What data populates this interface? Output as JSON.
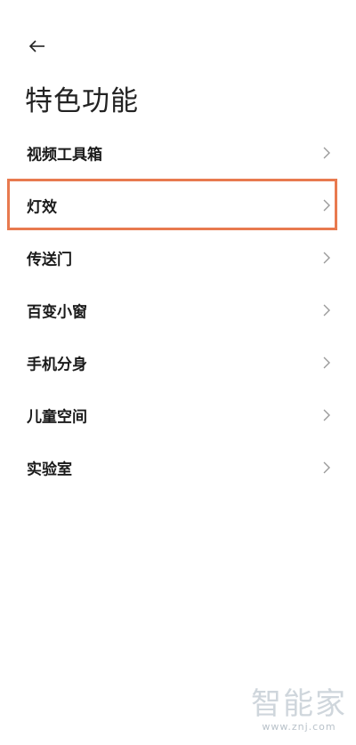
{
  "header": {
    "back_icon": "arrow-left-icon",
    "title": "特色功能"
  },
  "menu": {
    "items": [
      {
        "label": "视频工具箱",
        "icon": "chevron-right-icon"
      },
      {
        "label": "灯效",
        "icon": "chevron-right-icon",
        "highlighted": true
      },
      {
        "label": "传送门",
        "icon": "chevron-right-icon"
      },
      {
        "label": "百变小窗",
        "icon": "chevron-right-icon"
      },
      {
        "label": "手机分身",
        "icon": "chevron-right-icon"
      },
      {
        "label": "儿童空间",
        "icon": "chevron-right-icon"
      },
      {
        "label": "实验室",
        "icon": "chevron-right-icon"
      }
    ]
  },
  "highlight": {
    "color": "#e87a4f"
  },
  "watermark": {
    "text": "智能家",
    "url": "www.znj.com"
  }
}
